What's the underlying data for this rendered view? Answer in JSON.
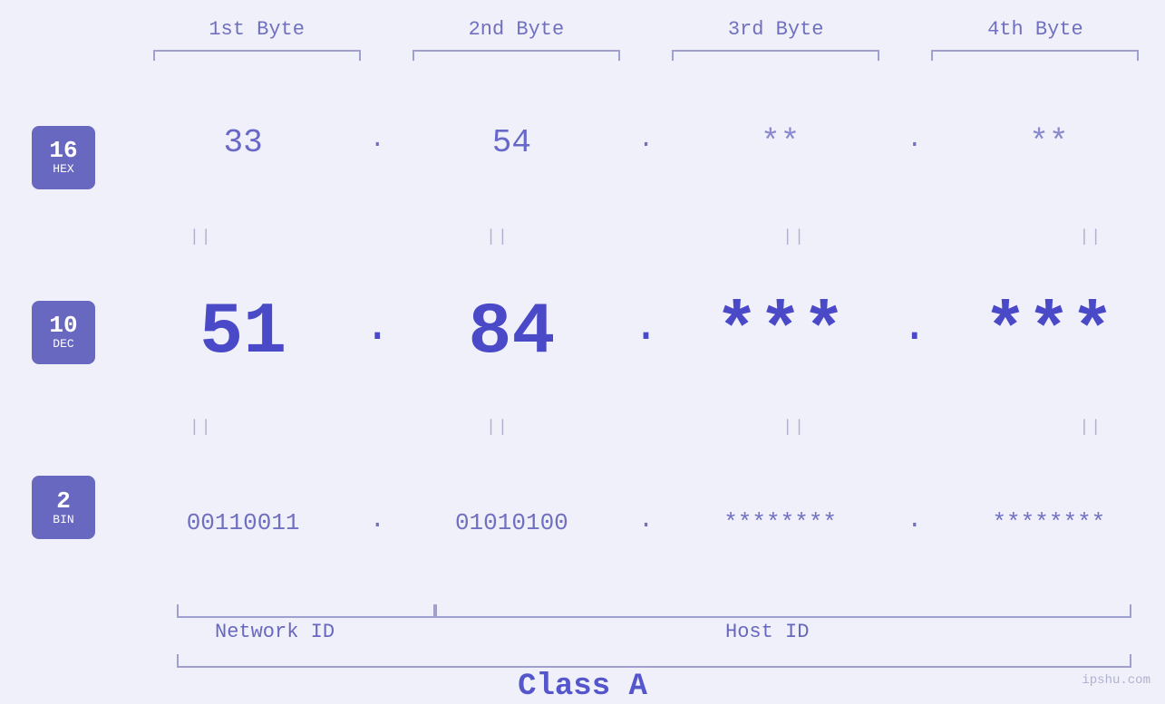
{
  "byteHeaders": {
    "b1": "1st Byte",
    "b2": "2nd Byte",
    "b3": "3rd Byte",
    "b4": "4th Byte"
  },
  "badges": {
    "hex": {
      "number": "16",
      "label": "HEX"
    },
    "dec": {
      "number": "10",
      "label": "DEC"
    },
    "bin": {
      "number": "2",
      "label": "BIN"
    }
  },
  "hexRow": {
    "b1": "33",
    "b2": "54",
    "b3": "**",
    "b4": "**"
  },
  "decRow": {
    "b1": "51",
    "b2": "84",
    "b3": "***",
    "b4": "***"
  },
  "binRow": {
    "b1": "00110011",
    "b2": "01010100",
    "b3": "********",
    "b4": "********"
  },
  "labels": {
    "networkId": "Network ID",
    "hostId": "Host ID",
    "classA": "Class A"
  },
  "watermark": "ipshu.com"
}
